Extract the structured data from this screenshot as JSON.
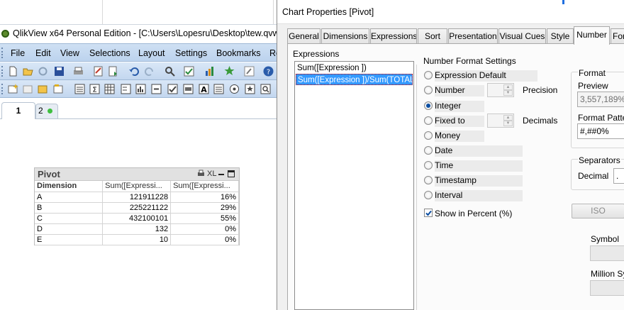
{
  "app": {
    "window_title": "QlikView x64 Personal Edition - [C:\\Users\\Lopesru\\Desktop\\tew.qvw*]"
  },
  "menu": [
    "File",
    "Edit",
    "View",
    "Selections",
    "Layout",
    "Settings",
    "Bookmarks",
    "Re"
  ],
  "sheet_tabs": [
    {
      "label": "1",
      "active": true
    },
    {
      "label": "2",
      "active": false
    }
  ],
  "pivot": {
    "title": "Pivot",
    "caption_icons": [
      "print-icon",
      "excel-icon",
      "minimize-icon",
      "maximize-icon"
    ],
    "xl_label": "XL",
    "headers": [
      "Dimension",
      "Sum([Expressi...",
      "Sum([Expressi..."
    ],
    "rows": [
      [
        "A",
        "121911228",
        "16%"
      ],
      [
        "B",
        "225221122",
        "29%"
      ],
      [
        "C",
        "432100101",
        "55%"
      ],
      [
        "D",
        "132",
        "0%"
      ],
      [
        "E",
        "10",
        "0%"
      ]
    ]
  },
  "dialog": {
    "title": "Chart Properties [Pivot]",
    "tabs": [
      "General",
      "Dimensions",
      "Expressions",
      "Sort",
      "Presentation",
      "Visual Cues",
      "Style",
      "Number",
      "For"
    ],
    "active_tab": "Number",
    "expressions_label": "Expressions",
    "expressions": [
      "Sum([Expression ])",
      "Sum([Expression ])/Sum(TOTAL [E"
    ],
    "number_format_settings_label": "Number Format Settings",
    "format_options": [
      "Expression Default",
      "Number",
      "Integer",
      "Fixed to",
      "Money",
      "Date",
      "Time",
      "Timestamp",
      "Interval"
    ],
    "selected_format": "Integer",
    "precision_label": "Precision",
    "decimals_label": "Decimals",
    "show_in_percent_label": "Show in Percent (%)",
    "show_in_percent_checked": true,
    "format_group_label": "Format",
    "preview_label": "Preview",
    "preview_value": "3,557,189%",
    "format_pattern_label": "Format Pattern",
    "format_pattern_value": "#,##0%",
    "separators_label": "Separators",
    "decimal_label": "Decimal",
    "decimal_value": ".",
    "iso_button": "ISO",
    "symbol_label": "Symbol",
    "million_symbol_label": "Million Sym"
  },
  "colors": {
    "selection_blue": "#3399ff",
    "menubar_blue": "#c6dbf2",
    "status_dot_green": "#3fbf3f"
  }
}
